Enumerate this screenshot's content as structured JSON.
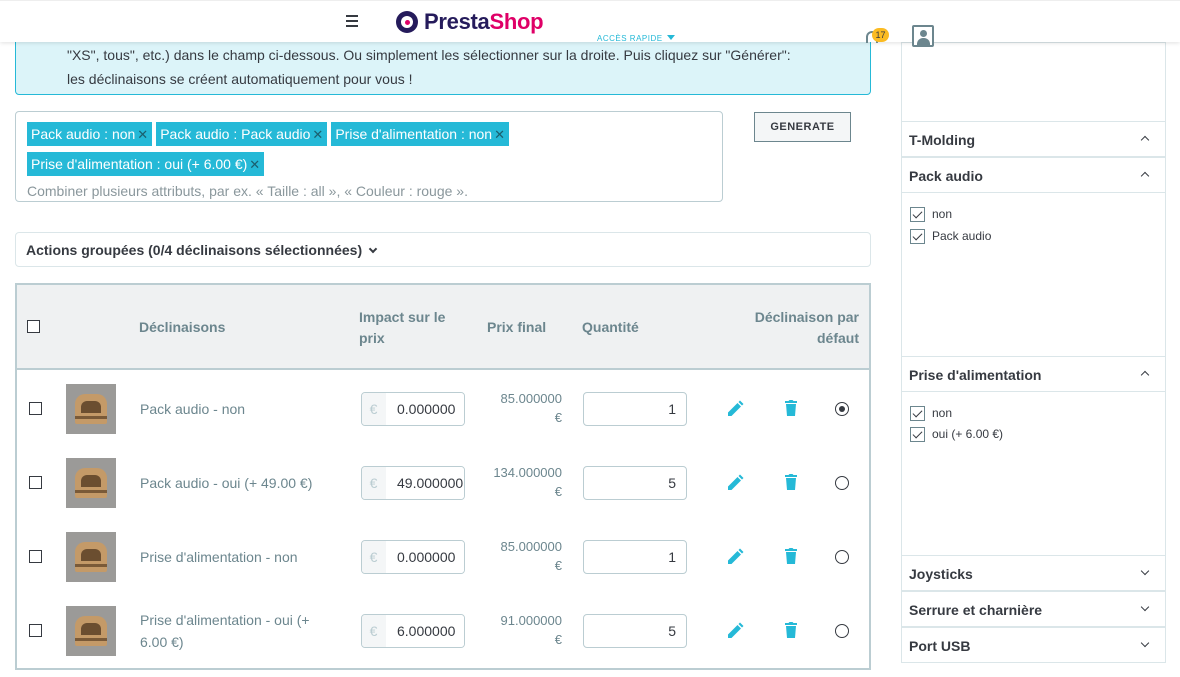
{
  "header": {
    "logo_presta": "Presta",
    "logo_shop": "Shop",
    "quick_access": "ACCÈS RAPIDE",
    "notifications_count": "17"
  },
  "alert": {
    "line1": "\"XS\", tous\", etc.) dans le champ ci-dessous. Ou simplement les sélectionner sur la droite. Puis cliquez sur \"Générer\":",
    "line2": "les déclinaisons se créent automatiquement pour vous !"
  },
  "generator": {
    "tags": [
      "Pack audio : non",
      "Pack audio : Pack audio",
      "Prise d'alimentation : non",
      "Prise d'alimentation : oui (+ 6.00 €)"
    ],
    "placeholder": "Combiner plusieurs attributs, par ex. « Taille : all », « Couleur : rouge ».",
    "button": "GENERATE"
  },
  "bulk_actions": {
    "label": "Actions groupées (0/4 déclinaisons sélectionnées)"
  },
  "table": {
    "headers": {
      "combinations": "Déclinaisons",
      "impact_l1": "Impact sur le",
      "impact_l2": "prix",
      "final_price": "Prix final",
      "quantity": "Quantité",
      "default_l1": "Déclinaison par",
      "default_l2": "défaut"
    },
    "currency": "€",
    "rows": [
      {
        "name_l1": "Pack audio - non",
        "name_l2": "",
        "impact": "0.000000",
        "final_l1": "85.000000",
        "final_l2": "€",
        "qty": "1",
        "default": true
      },
      {
        "name_l1": "Pack audio - oui (+ 49.00 €)",
        "name_l2": "",
        "impact": "49.000000",
        "final_l1": "134.000000",
        "final_l2": "€",
        "qty": "5",
        "default": false
      },
      {
        "name_l1": "Prise d'alimentation - non",
        "name_l2": "",
        "impact": "0.000000",
        "final_l1": "85.000000",
        "final_l2": "€",
        "qty": "1",
        "default": false
      },
      {
        "name_l1": "Prise d'alimentation - oui (+",
        "name_l2": "6.00 €)",
        "impact": "6.000000",
        "final_l1": "91.000000",
        "final_l2": "€",
        "qty": "5",
        "default": false
      }
    ]
  },
  "sidebar": {
    "sections": [
      {
        "title": "T-Molding",
        "expanded": true,
        "options": []
      },
      {
        "title": "Pack audio",
        "expanded": true,
        "options": [
          "non",
          "Pack audio"
        ]
      },
      {
        "title": "Prise d'alimentation",
        "expanded": true,
        "options": [
          "non",
          "oui (+ 6.00 €)"
        ]
      },
      {
        "title": "Joysticks",
        "expanded": false,
        "options": []
      },
      {
        "title": "Serrure et charnière",
        "expanded": false,
        "options": []
      },
      {
        "title": "Port USB",
        "expanded": false,
        "options": []
      }
    ]
  },
  "colors": {
    "accent": "#25b9d7",
    "brand_dark": "#251b5b",
    "brand_pink": "#df0067",
    "badge": "#fbbb22"
  }
}
